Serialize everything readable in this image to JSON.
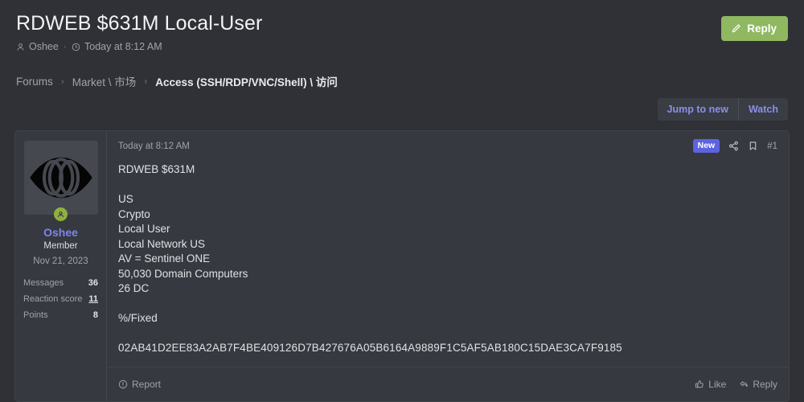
{
  "header": {
    "thread_title": "RDWEB $631M Local-User",
    "author": "Oshee",
    "author_icon": "person-icon",
    "separator": "·",
    "time_icon": "clock-icon",
    "timestamp": "Today at 8:12 AM",
    "reply_button": {
      "label": "Reply",
      "icon": "pencil-icon",
      "color": "#8fb861"
    }
  },
  "breadcrumb": {
    "items": [
      {
        "label": "Forums",
        "current": false
      },
      {
        "label": "Market \\ 市场",
        "current": false
      },
      {
        "label": "Access (SSH/RDP/VNC/Shell) \\ 访问",
        "current": true
      }
    ],
    "separator": "›"
  },
  "actionbar": {
    "jump_to_new": "Jump to new",
    "watch": "Watch",
    "link_color": "#8a8fe8"
  },
  "post": {
    "user": {
      "avatar_icon": "eye-avatar-icon",
      "online_badge_icon": "user-status-icon",
      "online_badge_color": "#8fb03e",
      "username": "Oshee",
      "username_color": "#7e84f0",
      "title": "Member",
      "join_date": "Nov 21, 2023",
      "stats": [
        {
          "label": "Messages",
          "value": "36",
          "link": false
        },
        {
          "label": "Reaction score",
          "value": "11",
          "link": true
        },
        {
          "label": "Points",
          "value": "8",
          "link": false
        }
      ]
    },
    "head": {
      "timestamp": "Today at 8:12 AM",
      "new_badge": "New",
      "new_badge_color": "#5d63e0",
      "share_icon": "share-icon",
      "bookmark_icon": "bookmark-icon",
      "post_number": "#1"
    },
    "body_lines": [
      "RDWEB $631M",
      "",
      "US",
      "Crypto",
      "Local User",
      "Local Network US",
      "AV = Sentinel ONE",
      "50,030 Domain Computers",
      "26 DC",
      "",
      "%/Fixed",
      "",
      "02AB41D2EE83A2AB7F4BE409126D7B427676A05B6164A9889F1C5AF5AB180C15DAE3CA7F9185"
    ],
    "footer": {
      "report": {
        "label": "Report",
        "icon": "report-icon"
      },
      "like": {
        "label": "Like",
        "icon": "thumbs-up-icon"
      },
      "reply": {
        "label": "Reply",
        "icon": "reply-arrow-icon"
      }
    }
  }
}
